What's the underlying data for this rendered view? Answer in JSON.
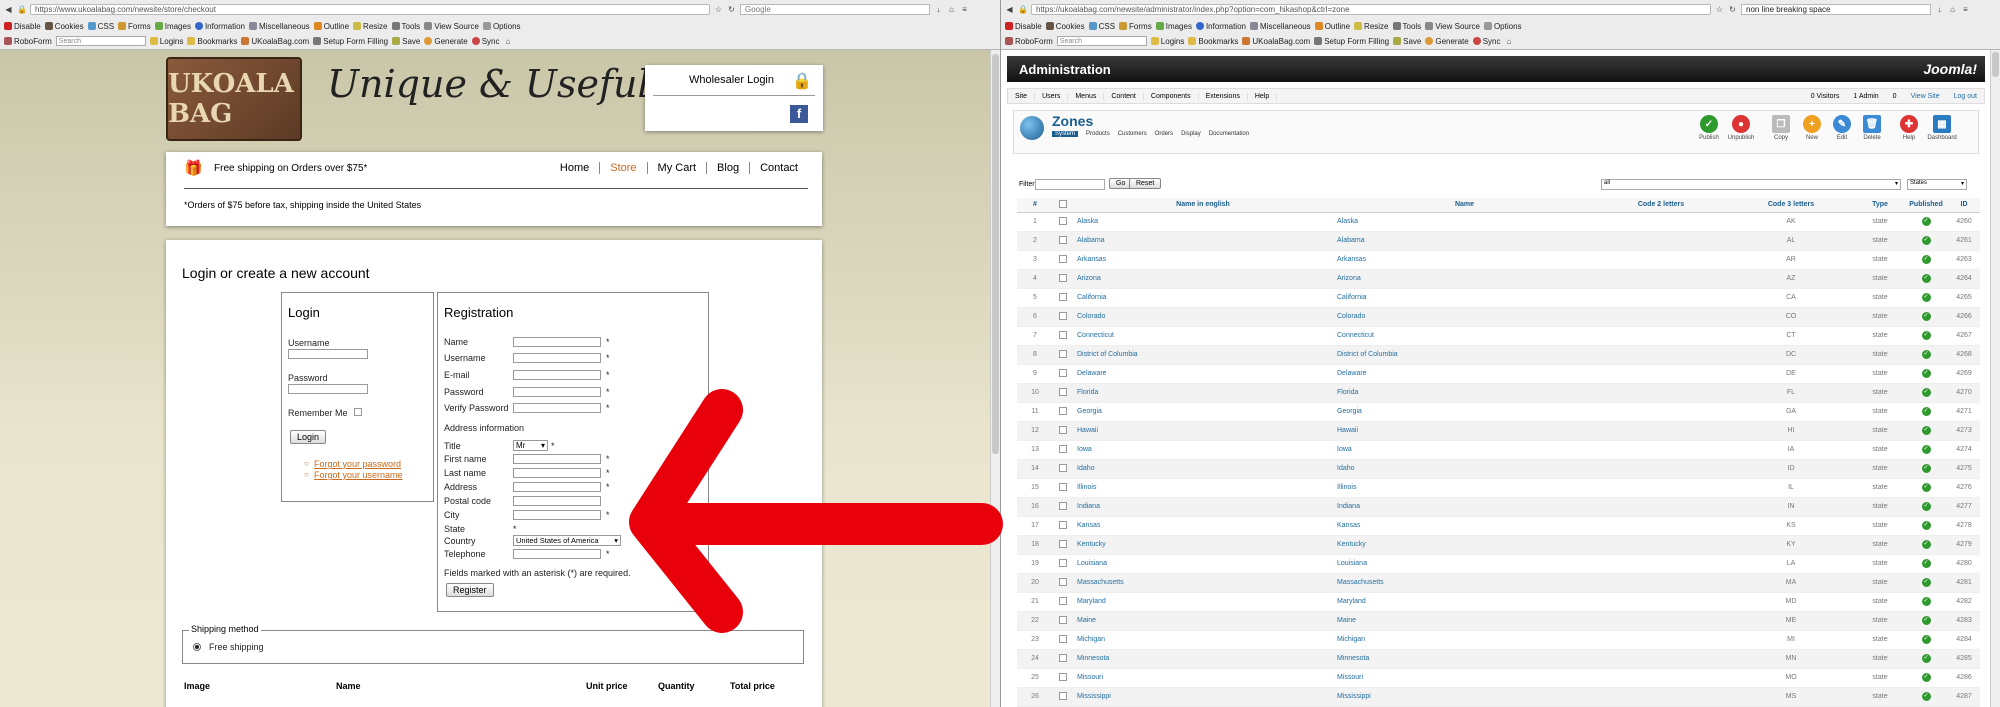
{
  "left_browser": {
    "url": "https://www.ukoalabag.com/newsite/store/checkout",
    "search_placeholder": "Google",
    "toolbar1": [
      "Disable",
      "Cookies",
      "CSS",
      "Forms",
      "Images",
      "Information",
      "Miscellaneous",
      "Outline",
      "Resize",
      "Tools",
      "View Source",
      "Options"
    ],
    "roboform": "RoboForm",
    "roboform_search": "Search",
    "toolbar2": [
      "Logins",
      "Bookmarks",
      "UKoalaBag.com",
      "Setup Form Filling",
      "Save",
      "Generate",
      "Sync"
    ]
  },
  "right_browser": {
    "url": "https://ukoalabag.com/newsite/administrator/index.php?option=com_hikashop&ctrl=zone",
    "search_value": "non line breaking space",
    "toolbar1": [
      "Disable",
      "Cookies",
      "CSS",
      "Forms",
      "Images",
      "Information",
      "Miscellaneous",
      "Outline",
      "Resize",
      "Tools",
      "View Source",
      "Options"
    ],
    "roboform": "RoboForm",
    "roboform_search": "Search",
    "toolbar2": [
      "Logins",
      "Bookmarks",
      "UKoalaBag.com",
      "Setup Form Filling",
      "Save",
      "Generate",
      "Sync"
    ]
  },
  "store": {
    "logo_text": "UKOALA BAG",
    "tagline": "Unique & Useful",
    "wholesaler_login": "Wholesaler Login",
    "facebook": "f",
    "free_shipping": "Free shipping on Orders over $75*",
    "nav": [
      "Home",
      "Store",
      "My Cart",
      "Blog",
      "Contact"
    ],
    "shipping_note": "*Orders of $75 before tax, shipping inside the United States",
    "heading": "Login or create a new account",
    "login": {
      "title": "Login",
      "username": "Username",
      "password": "Password",
      "remember": "Remember Me",
      "button": "Login",
      "forgot_password": "Forgot your password",
      "forgot_username": "Forgot your username"
    },
    "registration": {
      "title": "Registration",
      "fields": [
        "Name",
        "Username",
        "E-mail",
        "Password",
        "Verify Password"
      ],
      "address_info": "Address information",
      "title_label": "Title",
      "title_value": "Mr",
      "address_fields": [
        "First name",
        "Last name",
        "Address",
        "Postal code",
        "City",
        "State"
      ],
      "country_label": "Country",
      "country_value": "United States of America",
      "telephone": "Telephone",
      "required_note": "Fields marked with an asterisk (*) are required.",
      "button": "Register",
      "asterisk": "*"
    },
    "shipping_method": {
      "legend": "Shipping method",
      "option": "Free shipping"
    },
    "cart_headers": [
      "Image",
      "Name",
      "Unit price",
      "Quantity",
      "Total price"
    ]
  },
  "admin": {
    "header": "Administration",
    "brand": "Joomla!",
    "menu": [
      "Site",
      "Users",
      "Menus",
      "Content",
      "Components",
      "Extensions",
      "Help"
    ],
    "status": [
      "0 Visitors",
      "1 Admin",
      "0",
      "View Site",
      "Log out"
    ],
    "page_title": "Zones",
    "submenu": [
      "System",
      "Products",
      "Customers",
      "Orders",
      "Display",
      "Documentation"
    ],
    "actions": [
      "Publish",
      "Unpublish",
      "Copy",
      "New",
      "Edit",
      "Delete",
      "Help",
      "Dashboard"
    ],
    "filter_label": "Filter:",
    "go": "Go",
    "reset": "Reset",
    "filter_all": "all",
    "filter_type": "States",
    "columns": [
      "#",
      "",
      "Name in english",
      "Name",
      "Code 2 letters",
      "Code 3 letters",
      "Type",
      "Published",
      "ID"
    ],
    "rows": [
      {
        "n": "1",
        "en": "Alaska",
        "name": "Alaska",
        "c3": "AK",
        "type": "state",
        "id": "4260"
      },
      {
        "n": "2",
        "en": "Alabama",
        "name": "Alabama",
        "c3": "AL",
        "type": "state",
        "id": "4261"
      },
      {
        "n": "3",
        "en": "Arkansas",
        "name": "Arkansas",
        "c3": "AR",
        "type": "state",
        "id": "4263"
      },
      {
        "n": "4",
        "en": "Arizona",
        "name": "Arizona",
        "c3": "AZ",
        "type": "state",
        "id": "4264"
      },
      {
        "n": "5",
        "en": "California",
        "name": "California",
        "c3": "CA",
        "type": "state",
        "id": "4265"
      },
      {
        "n": "6",
        "en": "Colorado",
        "name": "Colorado",
        "c3": "CO",
        "type": "state",
        "id": "4266"
      },
      {
        "n": "7",
        "en": "Connecticut",
        "name": "Connecticut",
        "c3": "CT",
        "type": "state",
        "id": "4267"
      },
      {
        "n": "8",
        "en": "District of Columbia",
        "name": "District of Columbia",
        "c3": "DC",
        "type": "state",
        "id": "4268"
      },
      {
        "n": "9",
        "en": "Delaware",
        "name": "Delaware",
        "c3": "DE",
        "type": "state",
        "id": "4269"
      },
      {
        "n": "10",
        "en": "Florida",
        "name": "Florida",
        "c3": "FL",
        "type": "state",
        "id": "4270"
      },
      {
        "n": "11",
        "en": "Georgia",
        "name": "Georgia",
        "c3": "GA",
        "type": "state",
        "id": "4271"
      },
      {
        "n": "12",
        "en": "Hawaii",
        "name": "Hawaii",
        "c3": "HI",
        "type": "state",
        "id": "4273"
      },
      {
        "n": "13",
        "en": "Iowa",
        "name": "Iowa",
        "c3": "IA",
        "type": "state",
        "id": "4274"
      },
      {
        "n": "14",
        "en": "Idaho",
        "name": "Idaho",
        "c3": "ID",
        "type": "state",
        "id": "4275"
      },
      {
        "n": "15",
        "en": "Illinois",
        "name": "Illinois",
        "c3": "IL",
        "type": "state",
        "id": "4276"
      },
      {
        "n": "16",
        "en": "Indiana",
        "name": "Indiana",
        "c3": "IN",
        "type": "state",
        "id": "4277"
      },
      {
        "n": "17",
        "en": "Kansas",
        "name": "Kansas",
        "c3": "KS",
        "type": "state",
        "id": "4278"
      },
      {
        "n": "18",
        "en": "Kentucky",
        "name": "Kentucky",
        "c3": "KY",
        "type": "state",
        "id": "4279"
      },
      {
        "n": "19",
        "en": "Louisiana",
        "name": "Louisiana",
        "c3": "LA",
        "type": "state",
        "id": "4280"
      },
      {
        "n": "20",
        "en": "Massachusetts",
        "name": "Massachusetts",
        "c3": "MA",
        "type": "state",
        "id": "4281"
      },
      {
        "n": "21",
        "en": "Maryland",
        "name": "Maryland",
        "c3": "MD",
        "type": "state",
        "id": "4282"
      },
      {
        "n": "22",
        "en": "Maine",
        "name": "Maine",
        "c3": "ME",
        "type": "state",
        "id": "4283"
      },
      {
        "n": "23",
        "en": "Michigan",
        "name": "Michigan",
        "c3": "MI",
        "type": "state",
        "id": "4284"
      },
      {
        "n": "24",
        "en": "Minnesota",
        "name": "Minnesota",
        "c3": "MN",
        "type": "state",
        "id": "4285"
      },
      {
        "n": "25",
        "en": "Missouri",
        "name": "Missouri",
        "c3": "MO",
        "type": "state",
        "id": "4286"
      },
      {
        "n": "26",
        "en": "Mississippi",
        "name": "Mississippi",
        "c3": "MS",
        "type": "state",
        "id": "4287"
      }
    ]
  },
  "annotation_color": "#e8000b"
}
